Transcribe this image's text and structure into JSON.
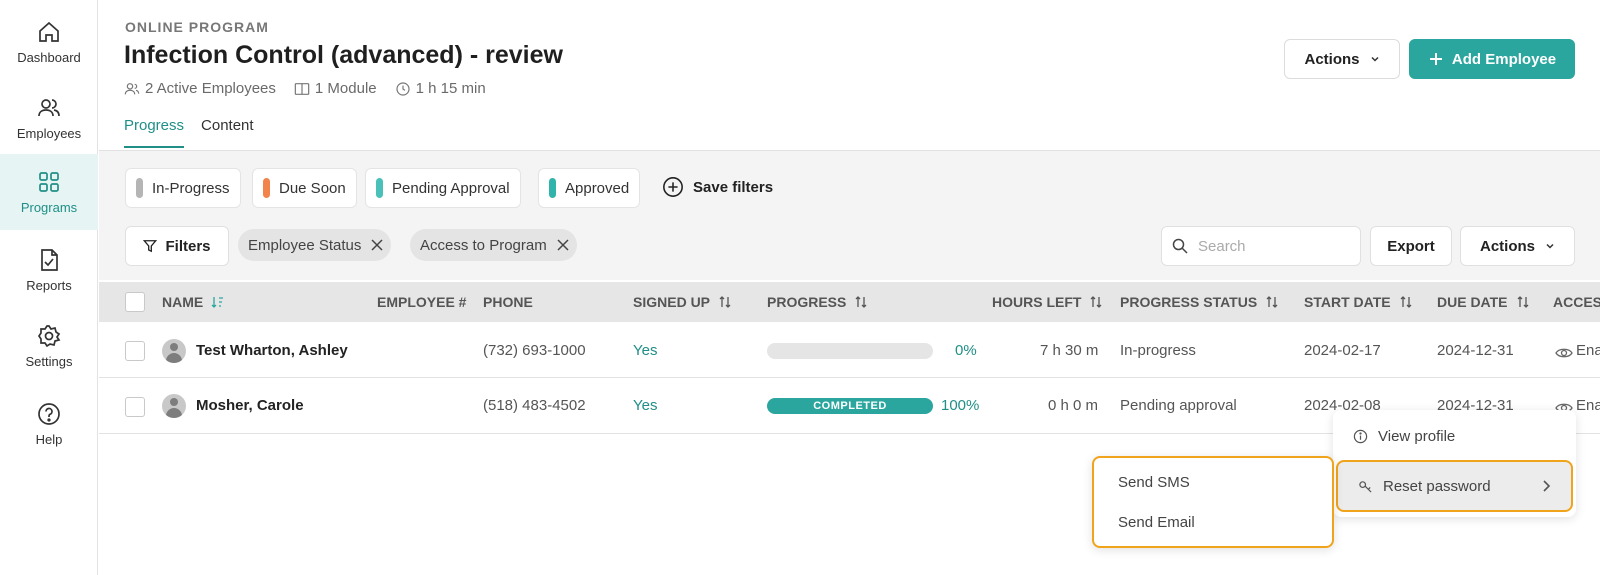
{
  "sidebar": {
    "items": [
      {
        "label": "Dashboard",
        "icon": "home-icon"
      },
      {
        "label": "Employees",
        "icon": "users-icon"
      },
      {
        "label": "Programs",
        "icon": "grid-icon",
        "active": true
      },
      {
        "label": "Reports",
        "icon": "report-icon"
      },
      {
        "label": "Settings",
        "icon": "gear-icon"
      },
      {
        "label": "Help",
        "icon": "help-icon"
      }
    ]
  },
  "header": {
    "eyebrow": "ONLINE PROGRAM",
    "title": "Infection Control (advanced) - review",
    "meta": {
      "employees": "2 Active Employees",
      "modules": "1 Module",
      "duration": "1 h 15 min"
    },
    "actions_label": "Actions",
    "add_label": "Add Employee"
  },
  "tabs": [
    {
      "label": "Progress",
      "active": true
    },
    {
      "label": "Content",
      "active": false
    }
  ],
  "status_chips": [
    {
      "label": "In-Progress",
      "color": "#b5b5b5"
    },
    {
      "label": "Due Soon",
      "color": "#f2834a"
    },
    {
      "label": "Pending Approval",
      "color": "#49c0b8"
    },
    {
      "label": "Approved",
      "color": "#2fb3aa"
    }
  ],
  "save_filters_label": "Save filters",
  "toolbar": {
    "filters_label": "Filters",
    "tags": [
      "Employee Status",
      "Access to Program"
    ],
    "search_placeholder": "Search",
    "export_label": "Export",
    "actions_label": "Actions"
  },
  "table": {
    "columns": [
      "NAME",
      "EMPLOYEE #",
      "PHONE",
      "SIGNED UP",
      "PROGRESS",
      "HOURS LEFT",
      "PROGRESS STATUS",
      "START DATE",
      "DUE DATE",
      "ACCES"
    ],
    "rows": [
      {
        "name": "Test Wharton, Ashley",
        "employee_no": "",
        "phone": "(732) 693-1000",
        "signed_up": "Yes",
        "progress": 0,
        "progress_label": "0%",
        "progress_bar_text": "",
        "hours_left": "7 h 30 m",
        "status": "In-progress",
        "start": "2024-02-17",
        "due": "2024-12-31",
        "access": "Ena"
      },
      {
        "name": "Mosher, Carole",
        "employee_no": "",
        "phone": "(518) 483-4502",
        "signed_up": "Yes",
        "progress": 100,
        "progress_label": "100%",
        "progress_bar_text": "COMPLETED",
        "hours_left": "0 h 0 m",
        "status": "Pending approval",
        "start": "2024-02-08",
        "due": "2024-12-31",
        "access": "Ena"
      }
    ]
  },
  "context_menu": {
    "items": [
      {
        "label": "View profile",
        "icon": "info-icon"
      },
      {
        "label": "Reset password",
        "icon": "key-icon"
      }
    ],
    "submenu": [
      "Send SMS",
      "Send Email"
    ]
  },
  "colors": {
    "accent": "#2aa69e",
    "highlight": "#f0a41c"
  }
}
